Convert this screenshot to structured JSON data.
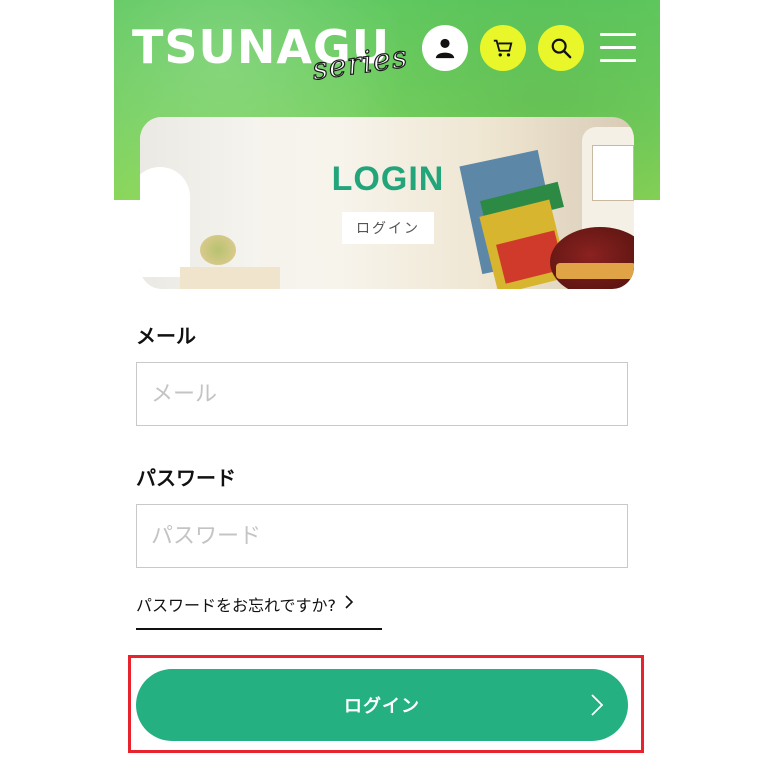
{
  "header": {
    "logo_main": "TSUNAGU",
    "logo_sub": "series",
    "icons": {
      "user": "user-icon",
      "cart": "cart-icon",
      "search": "search-icon",
      "menu": "hamburger-menu-icon"
    },
    "colors": {
      "header_green": "#6ccb5f",
      "icon_yellow": "#e9f72a"
    }
  },
  "banner": {
    "title": "LOGIN",
    "subtitle": "ログイン"
  },
  "form": {
    "email": {
      "label": "メール",
      "placeholder": "メール",
      "value": ""
    },
    "password": {
      "label": "パスワード",
      "placeholder": "パスワード",
      "value": ""
    },
    "forgot_link": "パスワードをお忘れですか?",
    "submit_label": "ログイン"
  },
  "colors": {
    "accent_green": "#24b080",
    "highlight_red": "#e8232d"
  }
}
